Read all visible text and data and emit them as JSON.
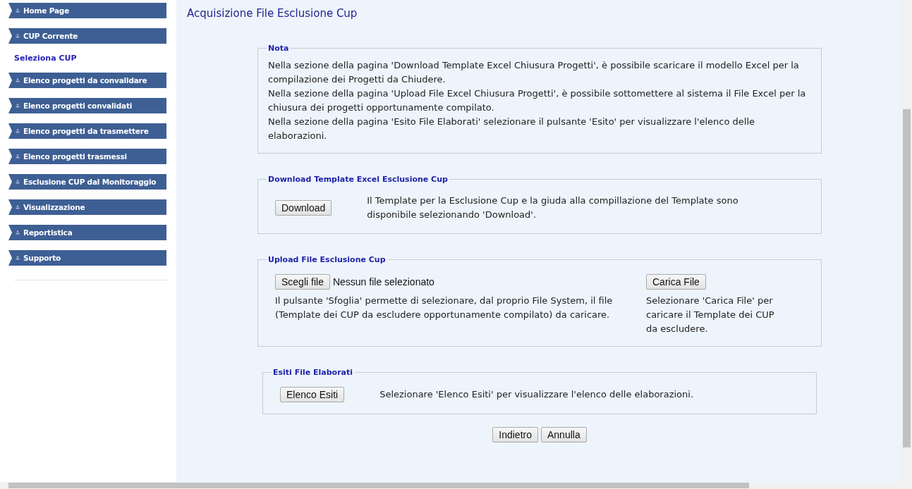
{
  "sidebar": {
    "items": [
      {
        "kind": "menu",
        "label": "Home Page"
      },
      {
        "kind": "menu",
        "label": "CUP Corrente"
      },
      {
        "kind": "link",
        "label": "Seleziona CUP"
      },
      {
        "kind": "menu",
        "label": "Elenco progetti da convalidare"
      },
      {
        "kind": "menu",
        "label": "Elenco progetti convalidati"
      },
      {
        "kind": "menu",
        "label": "Elenco progetti da trasmettere"
      },
      {
        "kind": "menu",
        "label": "Elenco progetti trasmessi"
      },
      {
        "kind": "menu",
        "label": "Esclusione CUP dal Monitoraggio"
      },
      {
        "kind": "menu",
        "label": "Visualizzazione"
      },
      {
        "kind": "menu",
        "label": "Reportistica"
      },
      {
        "kind": "menu",
        "label": "Supporto"
      }
    ]
  },
  "page_title": "Acquisizione File Esclusione Cup",
  "nota": {
    "legend": "Nota",
    "paragraphs": [
      "Nella sezione della pagina 'Download Template Excel Chiusura Progetti', è possibile scaricare il modello Excel per la compilazione dei Progetti da Chiudere.",
      "Nella sezione della pagina 'Upload File Excel Chiusura Progetti', è possibile sottomettere al sistema il File Excel per la chiusura dei progetti opportunamente compilato.",
      "Nella sezione della pagina 'Esito File Elaborati' selezionare il pulsante 'Esito' per visualizzare l'elenco delle elaborazioni."
    ]
  },
  "download": {
    "legend": "Download Template Excel Esclusione Cup",
    "button": "Download",
    "text": "Il Template per la Esclusione Cup e la giuda alla compillazione del Template sono disponibile selezionando 'Download'."
  },
  "upload": {
    "legend": "Upload File Esclusione Cup",
    "choose_button": "Scegli file",
    "file_status": "Nessun file selezionato",
    "text": "Il pulsante 'Sfoglia' permette di selezionare, dal proprio File System, il file (Template dei CUP da escludere opportunamente compilato) da caricare.",
    "upload_button": "Carica File",
    "upload_text": "Selezionare 'Carica File' per caricare il Template dei CUP da escludere."
  },
  "esiti": {
    "legend": "Esiti File Elaborati",
    "button": "Elenco Esiti",
    "text": "Selezionare 'Elenco Esiti' per visualizzare l'elenco delle elaborazioni."
  },
  "footer_buttons": [
    "Indietro",
    "Annulla"
  ]
}
